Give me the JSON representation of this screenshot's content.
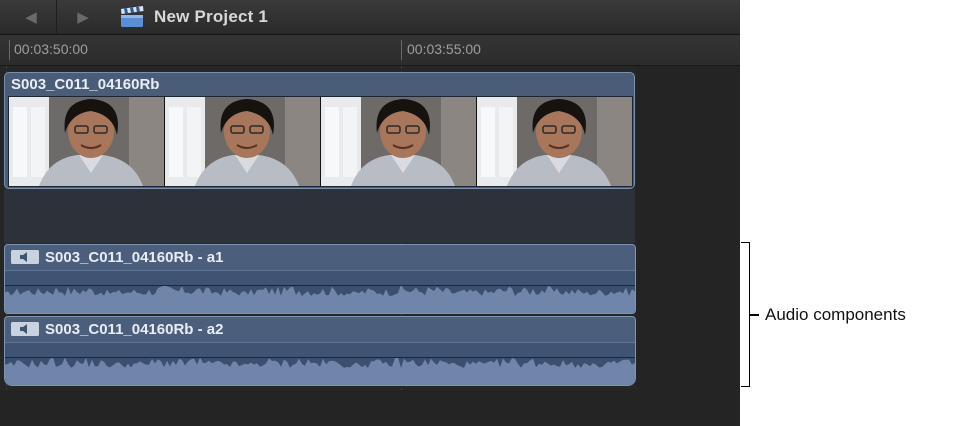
{
  "toolbar": {
    "back_icon": "back-arrow-icon",
    "forward_icon": "forward-arrow-icon",
    "project_icon": "clapperboard-icon",
    "project_title": "New Project 1"
  },
  "ruler": {
    "labels": [
      "00:03:50:00",
      "00:03:55:00"
    ]
  },
  "video_clip": {
    "name": "S003_C011_04160Rb",
    "frame_count": 4
  },
  "audio_components": [
    {
      "name": "S003_C011_04160Rb - a1",
      "icon": "speaker-icon"
    },
    {
      "name": "S003_C011_04160Rb - a2",
      "icon": "speaker-icon"
    }
  ],
  "callout": {
    "label": "Audio components"
  },
  "colors": {
    "clip_blue": "#4b5f7c",
    "timeline_bg": "#262626",
    "toolbar_bg": "#333333"
  }
}
